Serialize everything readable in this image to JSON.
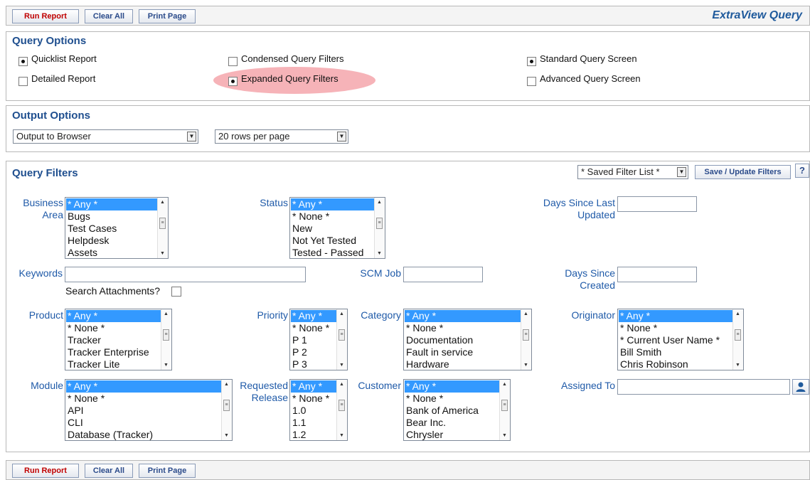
{
  "toolbar": {
    "run_report": "Run Report",
    "clear_all": "Clear All",
    "print_page": "Print Page",
    "app_title": "ExtraView Query"
  },
  "query_options": {
    "heading": "Query Options",
    "options": [
      {
        "label": "Quicklist Report",
        "checked": true
      },
      {
        "label": "Detailed Report",
        "checked": false
      },
      {
        "label": "Condensed Query Filters",
        "checked": false
      },
      {
        "label": "Expanded Query Filters",
        "checked": true
      },
      {
        "label": "Standard Query Screen",
        "checked": true
      },
      {
        "label": "Advanced Query Screen",
        "checked": false
      }
    ]
  },
  "output_options": {
    "heading": "Output Options",
    "output_select": "Output to Browser",
    "rows_select": "20 rows per page"
  },
  "query_filters": {
    "heading": "Query Filters",
    "saved_filter_list": "* Saved Filter List *",
    "save_update_button": "Save / Update Filters",
    "help_icon": "?",
    "labels": {
      "business_area": "Business Area",
      "status": "Status",
      "days_since_last_updated": "Days Since Last Updated",
      "keywords": "Keywords",
      "scm_job": "SCM Job",
      "days_since_created": "Days Since Created",
      "search_attachments": "Search Attachments?",
      "product": "Product",
      "priority": "Priority",
      "category": "Category",
      "originator": "Originator",
      "module": "Module",
      "requested_release": "Requested Release",
      "customer": "Customer",
      "assigned_to": "Assigned To"
    },
    "lists": {
      "business_area": [
        "* Any *",
        "Bugs",
        "Test Cases",
        "Helpdesk",
        "Assets"
      ],
      "status": [
        "* Any *",
        "* None *",
        "New",
        "Not Yet Tested",
        "Tested - Passed"
      ],
      "product": [
        "* Any *",
        "* None *",
        "Tracker",
        "Tracker Enterprise",
        "Tracker Lite"
      ],
      "priority": [
        "* Any *",
        "* None *",
        "P 1",
        "P 2",
        "P 3"
      ],
      "category": [
        "* Any *",
        "* None *",
        "Documentation",
        "Fault in service",
        "Hardware"
      ],
      "originator": [
        "* Any *",
        "* None *",
        "* Current User Name *",
        "Bill Smith",
        "Chris Robinson"
      ],
      "module": [
        "* Any *",
        "* None *",
        "API",
        "CLI",
        "Database (Tracker)"
      ],
      "requested_release": [
        "* Any *",
        "* None *",
        "1.0",
        "1.1",
        "1.2"
      ],
      "customer": [
        "* Any *",
        "* None *",
        "Bank of America",
        "Bear Inc.",
        "Chrysler"
      ]
    }
  },
  "icons": {
    "user_picker": "user-icon",
    "dropdown": "chevron-down-icon"
  },
  "colors": {
    "heading_blue": "#1f4f8f",
    "label_blue": "#1f5aa8",
    "selection_blue": "#3399ff",
    "highlight_pink": "#f4a6ab",
    "run_red": "#c00000"
  }
}
